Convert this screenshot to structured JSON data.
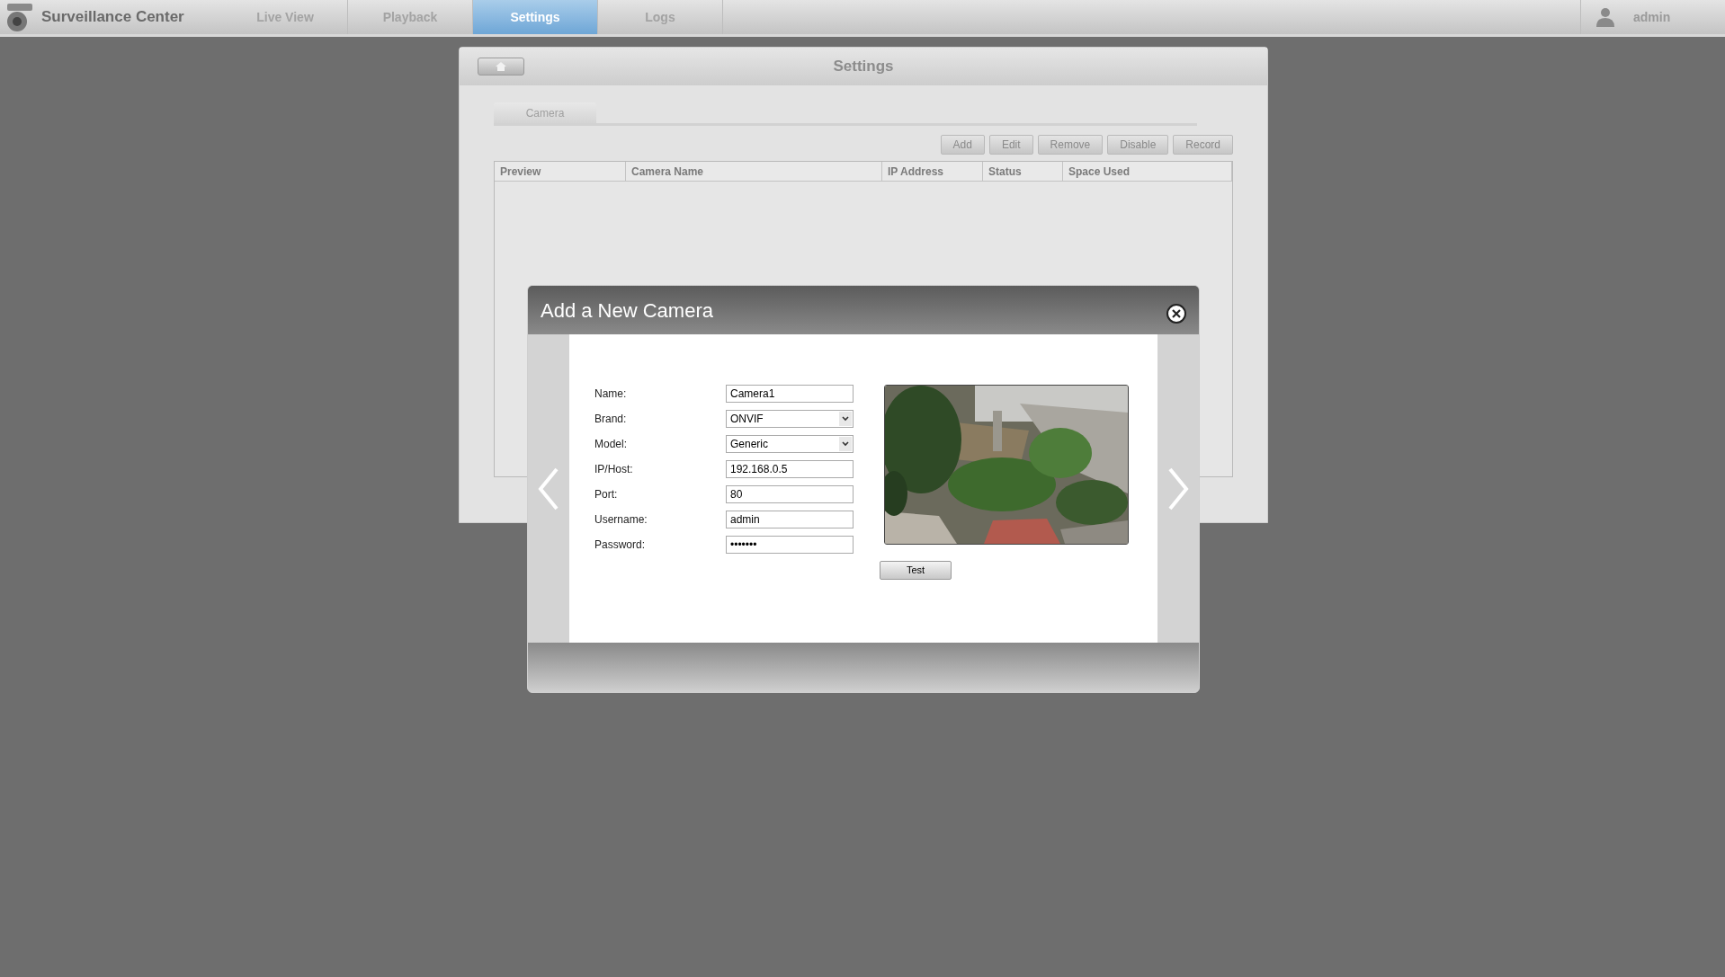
{
  "app": {
    "title": "Surveillance Center",
    "user": "admin"
  },
  "nav_tabs": [
    {
      "label": "Live View",
      "selected": false
    },
    {
      "label": "Playback",
      "selected": false
    },
    {
      "label": "Settings",
      "selected": true
    },
    {
      "label": "Logs",
      "selected": false
    }
  ],
  "settings": {
    "title": "Settings",
    "tabs": [
      {
        "label": "Camera",
        "selected": true
      }
    ],
    "toolbar": [
      "Add",
      "Edit",
      "Remove",
      "Disable",
      "Record"
    ],
    "table": {
      "columns": [
        "Preview",
        "Camera Name",
        "IP Address",
        "Status",
        "Space Used"
      ]
    }
  },
  "dialog": {
    "title": "Add a New Camera",
    "fields": [
      {
        "label": "Name:",
        "kind": "text",
        "value": "Camera1"
      },
      {
        "label": "Brand:",
        "kind": "select",
        "value": "ONVIF"
      },
      {
        "label": "Model:",
        "kind": "select",
        "value": "Generic"
      },
      {
        "label": "IP/Host:",
        "kind": "text",
        "value": "192.168.0.5"
      },
      {
        "label": "Port:",
        "kind": "text",
        "value": "80"
      },
      {
        "label": "Username:",
        "kind": "text",
        "value": "admin"
      },
      {
        "label": "Password:",
        "kind": "text",
        "value": "•••••••"
      }
    ],
    "test_button": "Test"
  }
}
